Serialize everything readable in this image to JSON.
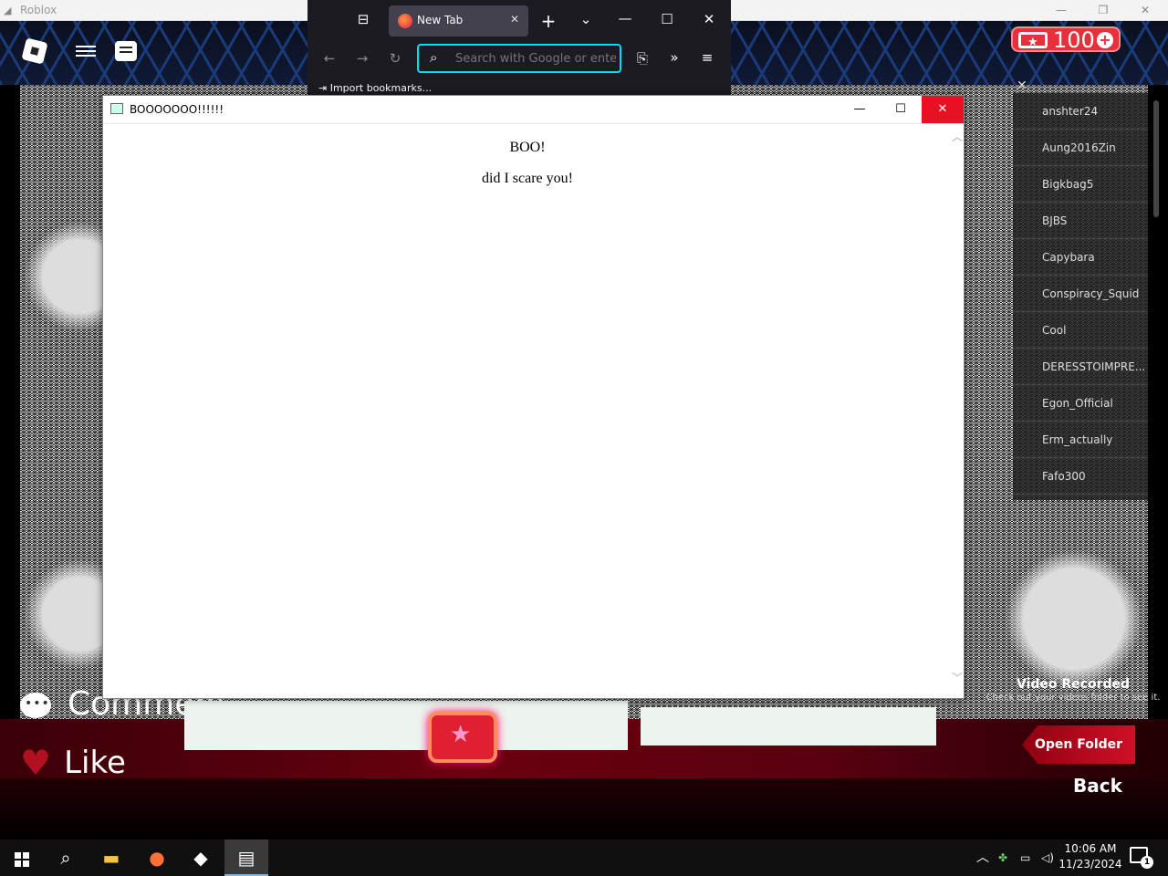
{
  "roblox_window": {
    "title": "Roblox"
  },
  "hud": {
    "robux_amount": "100"
  },
  "player_list": {
    "players": [
      "anshter24",
      "Aung2016Zin",
      "Bigkbag5",
      "BJBS",
      "Capybara",
      "Conspiracy_Squid",
      "Cool",
      "DERESSTOIMPRE...",
      "Egon_Official",
      "Erm_actually",
      "Fafo300"
    ]
  },
  "firefox": {
    "tab_title": "New Tab",
    "search_placeholder": "Search with Google or enter address",
    "bookmarks_import": "Import bookmarks..."
  },
  "dialog": {
    "title": "BOOOOOOO!!!!!!",
    "line1": "BOO!",
    "line2": "did I scare you!"
  },
  "bottom": {
    "comment_label": "Comment",
    "like_label": "Like",
    "video_recorded_title": "Video Recorded",
    "video_recorded_sub": "Check out your videos folder to see it.",
    "open_folder_label": "Open Folder",
    "back_label": "Back"
  },
  "taskbar": {
    "time": "10:06 AM",
    "date": "11/23/2024",
    "notification_count": "1"
  }
}
